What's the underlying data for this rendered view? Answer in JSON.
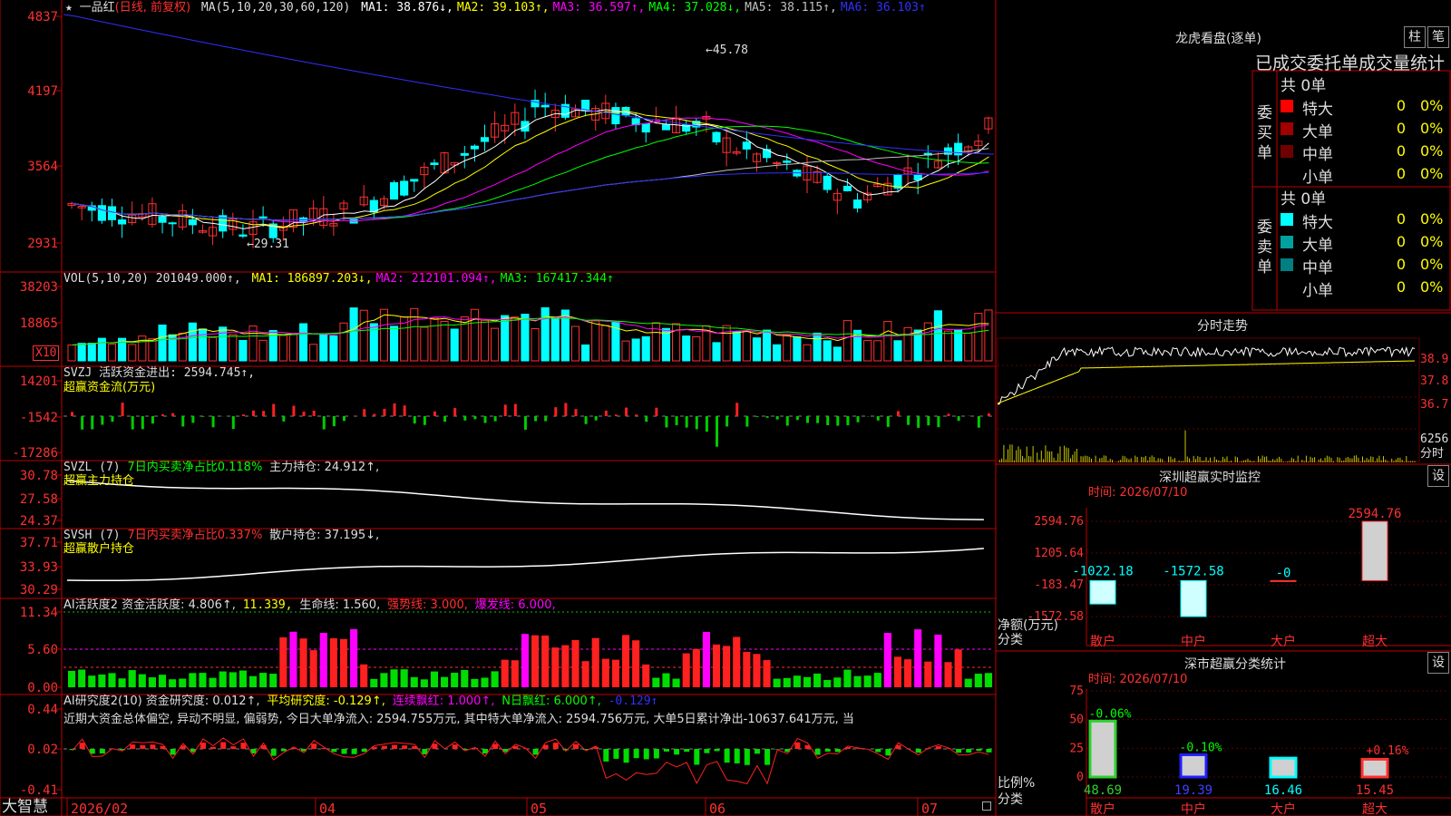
{
  "app": {
    "brand": "大智慧",
    "corner_icon": "small-square-icon"
  },
  "main_chart": {
    "title": "一品红",
    "mode": "(日线, 前复权)",
    "ma_params": "MA(5,10,20,30,60,120)",
    "ma_values": [
      {
        "label": "MA1: 38.876↓,",
        "color": "#ffffff"
      },
      {
        "label": "MA2: 39.103↑,",
        "color": "#ffff00"
      },
      {
        "label": "MA3: 36.597↑,",
        "color": "#ff00ff"
      },
      {
        "label": "MA4: 37.028↓,",
        "color": "#00ff00"
      },
      {
        "label": "MA5: 38.115↑,",
        "color": "#c0c0c0"
      },
      {
        "label": "MA6: 36.103↑",
        "color": "#3030ff"
      }
    ],
    "y_ticks": [
      "4837",
      "4197",
      "3564",
      "2931"
    ],
    "high_label": "45.78",
    "low_label": "29.31"
  },
  "vol": {
    "label": "VOL(5,10,20) 201049.000↑,",
    "ma": [
      {
        "label": "MA1: 186897.203↓,",
        "color": "#ffff00"
      },
      {
        "label": "MA2: 212101.094↑,",
        "color": "#ff00ff"
      },
      {
        "label": "MA3: 167417.344↑",
        "color": "#00ff00"
      }
    ],
    "y_ticks": [
      "38203",
      "18865"
    ],
    "unit": "X10"
  },
  "svzj": {
    "label": "SVZJ  活跃资金进出: 2594.745↑,",
    "sub": "超赢资金流(万元)",
    "y_ticks": [
      "14201",
      "-1542",
      "-17286"
    ]
  },
  "svzl": {
    "label": "SVZL (7)",
    "pct": "7日内买卖净占比0.118%",
    "hold": "主力持仓: 24.912↑,",
    "sub": "超赢主力持仓",
    "y_ticks": [
      "30.78",
      "27.58",
      "24.37"
    ]
  },
  "svsh": {
    "label": "SVSH (7)",
    "pct": "7日内买卖净占比0.337%",
    "hold": "散户持仓: 37.195↓,",
    "sub": "超赢散户持仓",
    "y_ticks": [
      "37.71",
      "33.93",
      "30.29"
    ]
  },
  "ai_active": {
    "label": "AI活跃度2 资金活跃度: 4.806↑,",
    "v2": "11.339,",
    "v3": "生命线: 1.560,",
    "v4": "强势线: 3.000,",
    "v5": "爆发线: 6.000,",
    "y_ticks": [
      "11.34",
      "5.60",
      "0.00"
    ]
  },
  "ai_research": {
    "label": "AI研究度2(10) 资金研究度: 0.012↑,",
    "avg": "平均研究度: -0.129↑,",
    "red": "连续飘红: 1.000↑,",
    "n": "N日飘红: 6.000↑,",
    "last": "-0.129↑",
    "comment": "近期大资金总体偏空, 异动不明显, 偏弱势, 今日大单净流入: 2594.755万元, 其中特大单净流入: 2594.756万元, 大单5日累计净出-10637.641万元, 当",
    "y_ticks": [
      "0.44",
      "0.02",
      "-0.41"
    ]
  },
  "x_axis": [
    "2026/02",
    "04",
    "05",
    "06",
    "07"
  ],
  "dragon": {
    "title": "龙虎看盘(逐单)",
    "btn_bar": "柱",
    "btn_pen": "笔",
    "header": "已成交委托单成交量统计",
    "buy_label": "委买单",
    "sell_label": "委卖单",
    "buy_total": "共 0单",
    "sell_total": "共 0单",
    "buy_rows": [
      {
        "name": "特大",
        "count": "0",
        "pct": "0%",
        "color": "#ff0000"
      },
      {
        "name": "大单",
        "count": "0",
        "pct": "0%",
        "color": "#a00000"
      },
      {
        "name": "中单",
        "count": "0",
        "pct": "0%",
        "color": "#700000"
      },
      {
        "name": "小单",
        "count": "0",
        "pct": "0%",
        "color": ""
      }
    ],
    "sell_rows": [
      {
        "name": "特大",
        "count": "0",
        "pct": "0%",
        "color": "#00ffff"
      },
      {
        "name": "大单",
        "count": "0",
        "pct": "0%",
        "color": "#00a0a0"
      },
      {
        "name": "中单",
        "count": "0",
        "pct": "0%",
        "color": "#008080"
      },
      {
        "name": "小单",
        "count": "0",
        "pct": "0%",
        "color": ""
      }
    ]
  },
  "intraday": {
    "title": "分时走势",
    "y_ticks": [
      "38.9",
      "37.8",
      "36.7"
    ],
    "vol_tick": "6256",
    "vol_unit": "分时"
  },
  "monitor": {
    "title": "深圳超赢实时监控",
    "btn": "设",
    "time": "时间: 2026/07/10",
    "y_ticks": [
      "2594.76",
      "1205.64",
      "-183.47",
      "-1572.58"
    ],
    "ylabel": "净额(万元)",
    "xlabel": "分类",
    "chart_data": {
      "type": "bar",
      "categories": [
        "散户",
        "中户",
        "大户",
        "超大"
      ],
      "values": [
        -1022.18,
        -1572.58,
        0,
        2594.76
      ],
      "value_labels": [
        "-1022.18",
        "-1572.58",
        "-0",
        "2594.76"
      ],
      "ylim": [
        -1572.58,
        2594.76
      ]
    }
  },
  "ratio": {
    "title": "深市超赢分类统计",
    "btn": "设",
    "time": "时间: 2026/07/10",
    "y_ticks": [
      "75",
      "50",
      "25",
      "0"
    ],
    "ylabel": "比例%",
    "xlabel": "分类",
    "chart_data": {
      "type": "bar",
      "categories": [
        "散户",
        "中户",
        "大户",
        "超大"
      ],
      "values": [
        48.69,
        19.39,
        16.46,
        15.45
      ],
      "value_labels": [
        "48.69",
        "19.39",
        "16.46",
        "15.45"
      ],
      "change_labels": [
        "-0.06%",
        "-0.10%",
        "",
        ""
      ],
      "top_change": "+0.16%",
      "ylim": [
        0,
        75
      ]
    }
  }
}
